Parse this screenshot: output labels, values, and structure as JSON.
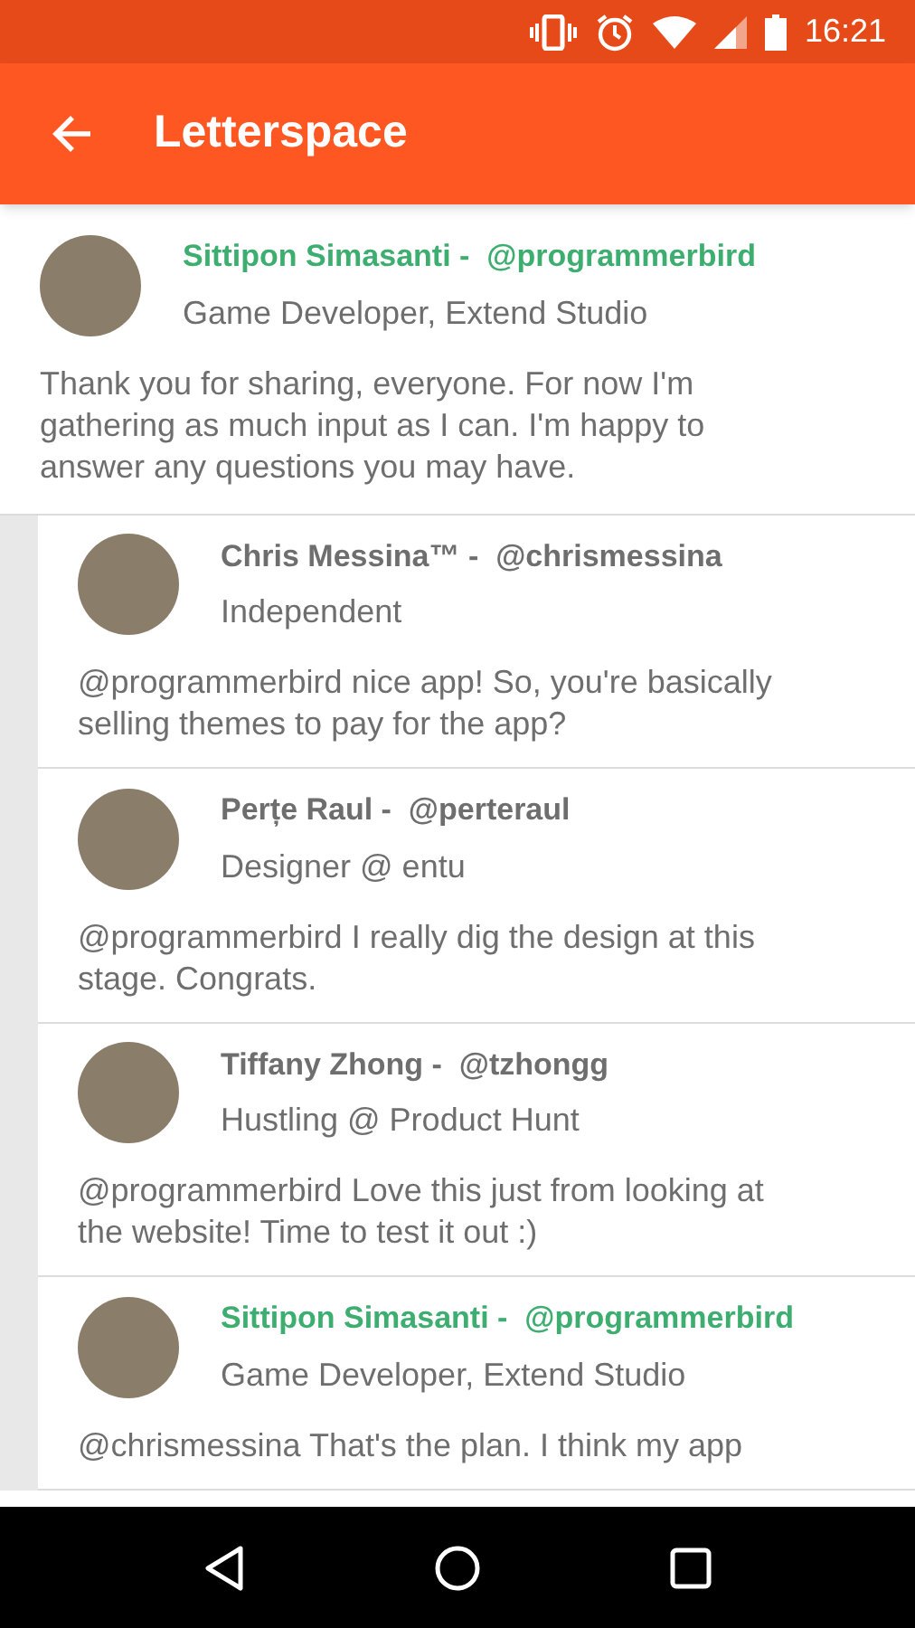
{
  "status_bar": {
    "time": "16:21"
  },
  "app_bar": {
    "title": "Letterspace"
  },
  "post": {
    "author": "Sittipon Simasanti -  @programmerbird",
    "highlighted": true,
    "subtitle": "Game Developer, Extend Studio",
    "body": "Thank you for sharing, everyone. For now I'm gathering as much input as I can. I'm happy to answer any questions you may have.",
    "replies": [
      {
        "author": "Chris Messina™ -  @chrismessina",
        "highlighted": false,
        "subtitle": "Independent",
        "body": "@programmerbird nice app! So, you're basically selling themes to pay for the app?"
      },
      {
        "author": "Perțe Raul -  @perteraul",
        "highlighted": false,
        "subtitle": "Designer @ entu",
        "body": "@programmerbird I really dig the design at this stage. Congrats."
      },
      {
        "author": "Tiffany Zhong -  @tzhongg",
        "highlighted": false,
        "subtitle": "Hustling @ Product Hunt",
        "body": "@programmerbird Love this just from looking at the website! Time to test it out :)"
      },
      {
        "author": "Sittipon Simasanti -  @programmerbird",
        "highlighted": true,
        "subtitle": "Game Developer, Extend Studio",
        "body": "@chrismessina That's the plan. I think my app"
      }
    ]
  }
}
